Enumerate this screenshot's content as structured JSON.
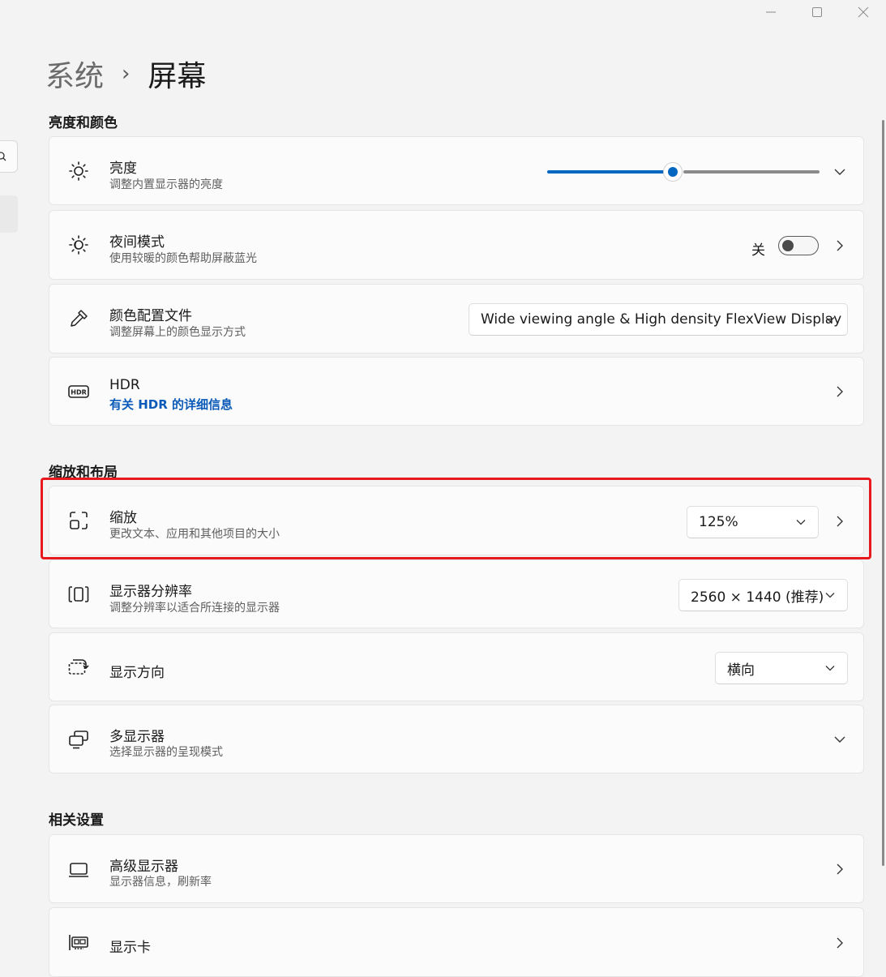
{
  "window": {
    "minimize_icon": "minimize-icon",
    "maximize_icon": "maximize-icon",
    "close_icon": "close-icon"
  },
  "breadcrumb": {
    "parent": "系统",
    "separator": "›",
    "current": "屏幕"
  },
  "sections": {
    "brightness_color": "亮度和颜色",
    "scale_layout": "缩放和布局",
    "related": "相关设置"
  },
  "cards": {
    "brightness": {
      "title": "亮度",
      "subtitle": "调整内置显示器的亮度",
      "slider_value_fraction": 0.46,
      "icon": "sun-icon"
    },
    "night_light": {
      "title": "夜间模式",
      "subtitle": "使用较暖的颜色帮助屏蔽蓝光",
      "state_label": "关",
      "toggle_on": false,
      "icon": "night-light-icon"
    },
    "color_profile": {
      "title": "颜色配置文件",
      "subtitle": "调整屏幕上的颜色显示方式",
      "selected": "Wide viewing angle & High density FlexView Display",
      "icon": "eyedropper-icon"
    },
    "hdr": {
      "title": "HDR",
      "link": "有关 HDR 的详细信息",
      "icon": "hdr-icon"
    },
    "scale": {
      "title": "缩放",
      "subtitle": "更改文本、应用和其他项目的大小",
      "selected": "125%",
      "icon": "scale-icon"
    },
    "resolution": {
      "title": "显示器分辨率",
      "subtitle": "调整分辨率以适合所连接的显示器",
      "selected": "2560 × 1440 (推荐)",
      "icon": "resolution-icon"
    },
    "orientation": {
      "title": "显示方向",
      "selected": "横向",
      "icon": "orientation-icon"
    },
    "multi_display": {
      "title": "多显示器",
      "subtitle": "选择显示器的呈现模式",
      "icon": "multi-display-icon"
    },
    "advanced_display": {
      "title": "高级显示器",
      "subtitle": "显示器信息，刷新率",
      "icon": "monitor-icon"
    },
    "graphics": {
      "title": "显示卡",
      "icon": "graphics-card-icon"
    }
  },
  "colors": {
    "accent": "#0067c0",
    "highlight": "#e8191e",
    "link": "#0b5ab8"
  }
}
